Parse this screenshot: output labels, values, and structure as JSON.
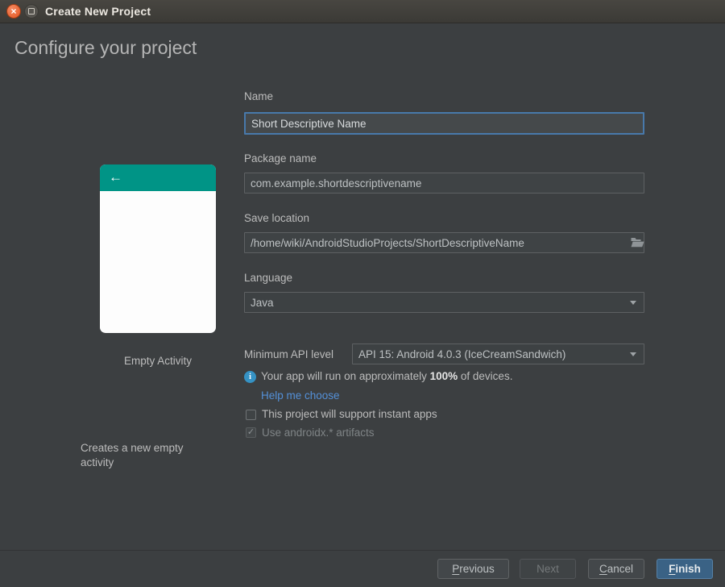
{
  "window": {
    "title": "Create New Project"
  },
  "header": {
    "title": "Configure your project"
  },
  "template_panel": {
    "name": "Empty Activity",
    "description": "Creates a new empty activity"
  },
  "form": {
    "name": {
      "label": "Name",
      "value": "Short Descriptive Name"
    },
    "package_name": {
      "label": "Package name",
      "value": "com.example.shortdescriptivename"
    },
    "save_location": {
      "label": "Save location",
      "value": "/home/wiki/AndroidStudioProjects/ShortDescriptiveName"
    },
    "language": {
      "label": "Language",
      "value": "Java"
    },
    "min_api": {
      "label": "Minimum API level",
      "value": "API 15: Android 4.0.3 (IceCreamSandwich)"
    },
    "api_note": {
      "prefix": "Your app will run on approximately ",
      "percent": "100%",
      "suffix": " of devices."
    },
    "help_link": "Help me choose",
    "checkboxes": [
      {
        "label": "This project will support instant apps",
        "checked": false,
        "enabled": true
      },
      {
        "label": "Use androidx.* artifacts",
        "checked": true,
        "enabled": false
      }
    ]
  },
  "footer": {
    "previous": "Previous",
    "next": "Next",
    "cancel": "Cancel",
    "finish": "Finish"
  },
  "colors": {
    "activity_header_teal": "#009486",
    "focus_border_blue": "#4879ab",
    "link_blue": "#5490d8",
    "info_icon_blue": "#3592c4",
    "finish_button_blue": "#3a6285",
    "close_button_orange": "#e2541f"
  }
}
